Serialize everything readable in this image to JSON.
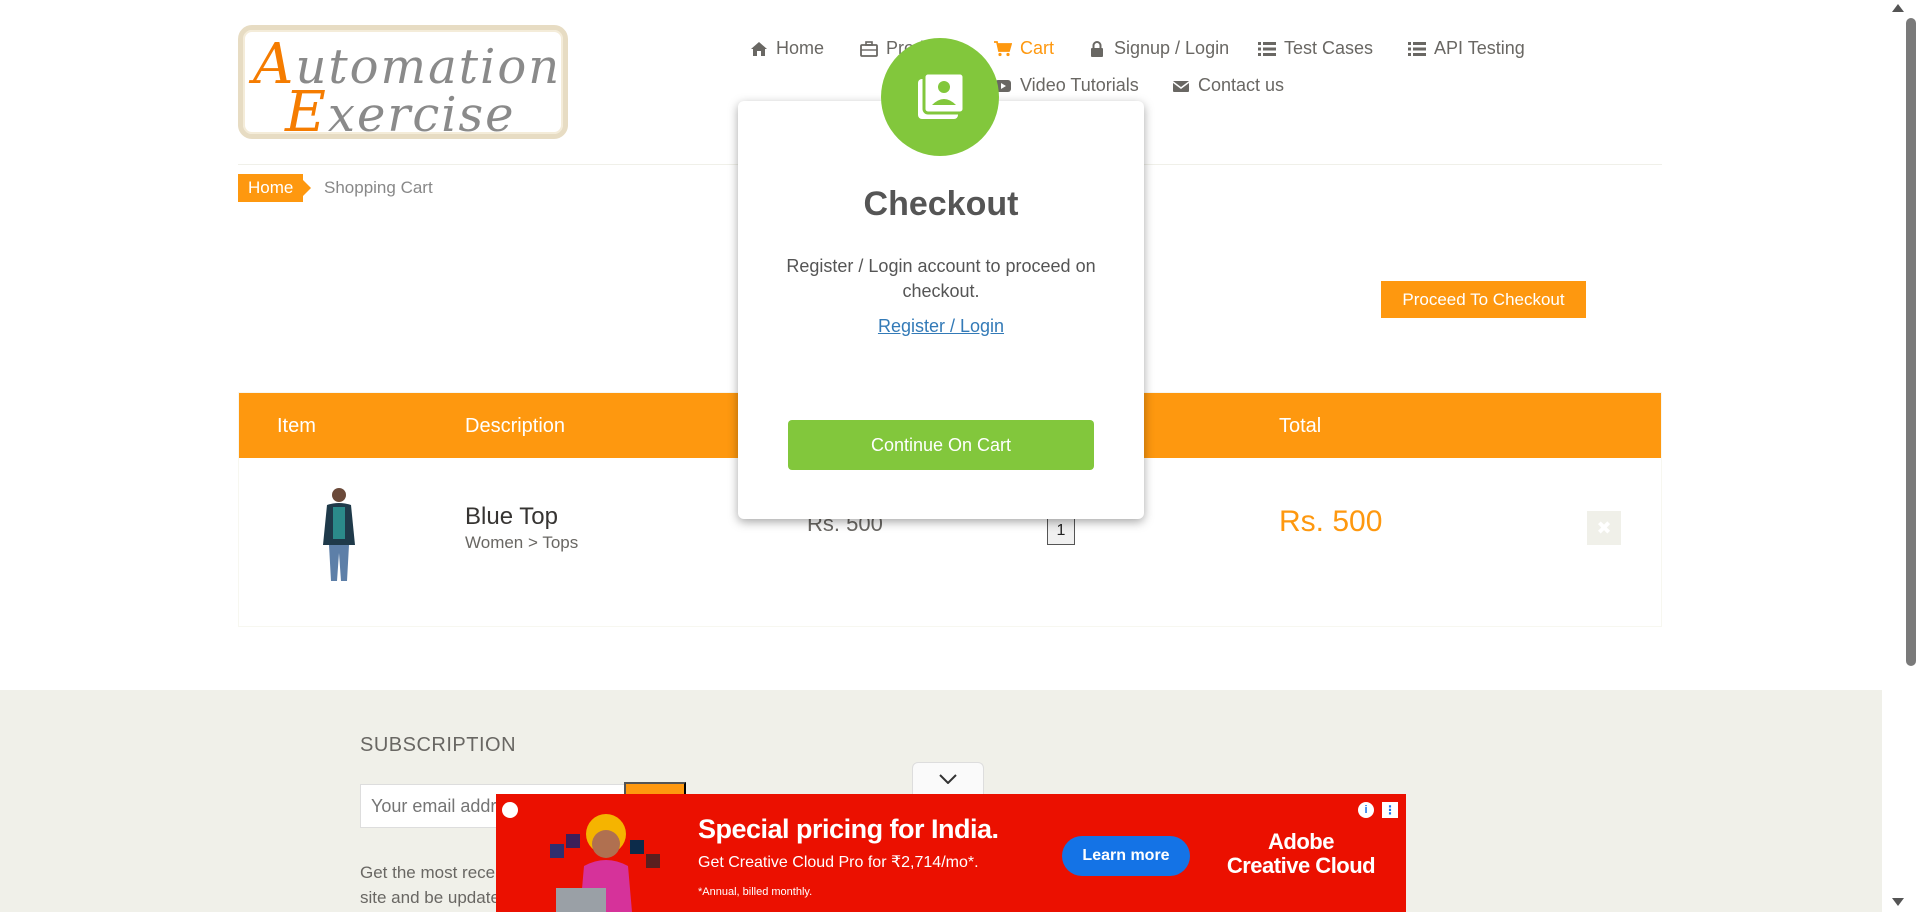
{
  "logo": {
    "line1_cap": "A",
    "line1_rest": "utomation",
    "line2_cap": "E",
    "line2_rest": "xercise"
  },
  "nav": {
    "home": "Home",
    "products": "Products",
    "cart": "Cart",
    "signup": "Signup / Login",
    "test_cases": "Test Cases",
    "api_testing": "API Testing",
    "video_tutorials": "Video Tutorials",
    "contact": "Contact us"
  },
  "breadcrumb": {
    "home": "Home",
    "current": "Shopping Cart"
  },
  "proceed_button": "Proceed To Checkout",
  "cart": {
    "headers": {
      "item": "Item",
      "description": "Description",
      "total": "Total"
    },
    "rows": [
      {
        "name": "Blue Top",
        "category": "Women > Tops",
        "price": "Rs. 500",
        "quantity": "1",
        "total": "Rs. 500",
        "delete_glyph": "✖"
      }
    ]
  },
  "footer": {
    "subscription_title": "SUBSCRIPTION",
    "email_placeholder": "Your email address",
    "description": "Get the most recent updates from our site and be updated your self..."
  },
  "modal": {
    "title": "Checkout",
    "text": "Register / Login account to proceed on checkout.",
    "link": "Register / Login",
    "button": "Continue On Cart"
  },
  "ad": {
    "headline": "Special pricing for India.",
    "subline": "Get Creative Cloud Pro for ₹2,714/mo*.",
    "fineprint": "*Annual, billed monthly.",
    "cta": "Learn more",
    "brand_line1": "Adobe",
    "brand_line2": "Creative Cloud",
    "info_glyph": "i",
    "menu_glyph": "⋮"
  },
  "colors": {
    "accent": "#fe980f",
    "modal_green": "#82c73c",
    "ad_red": "#eb1000",
    "ad_blue": "#1473e6"
  }
}
